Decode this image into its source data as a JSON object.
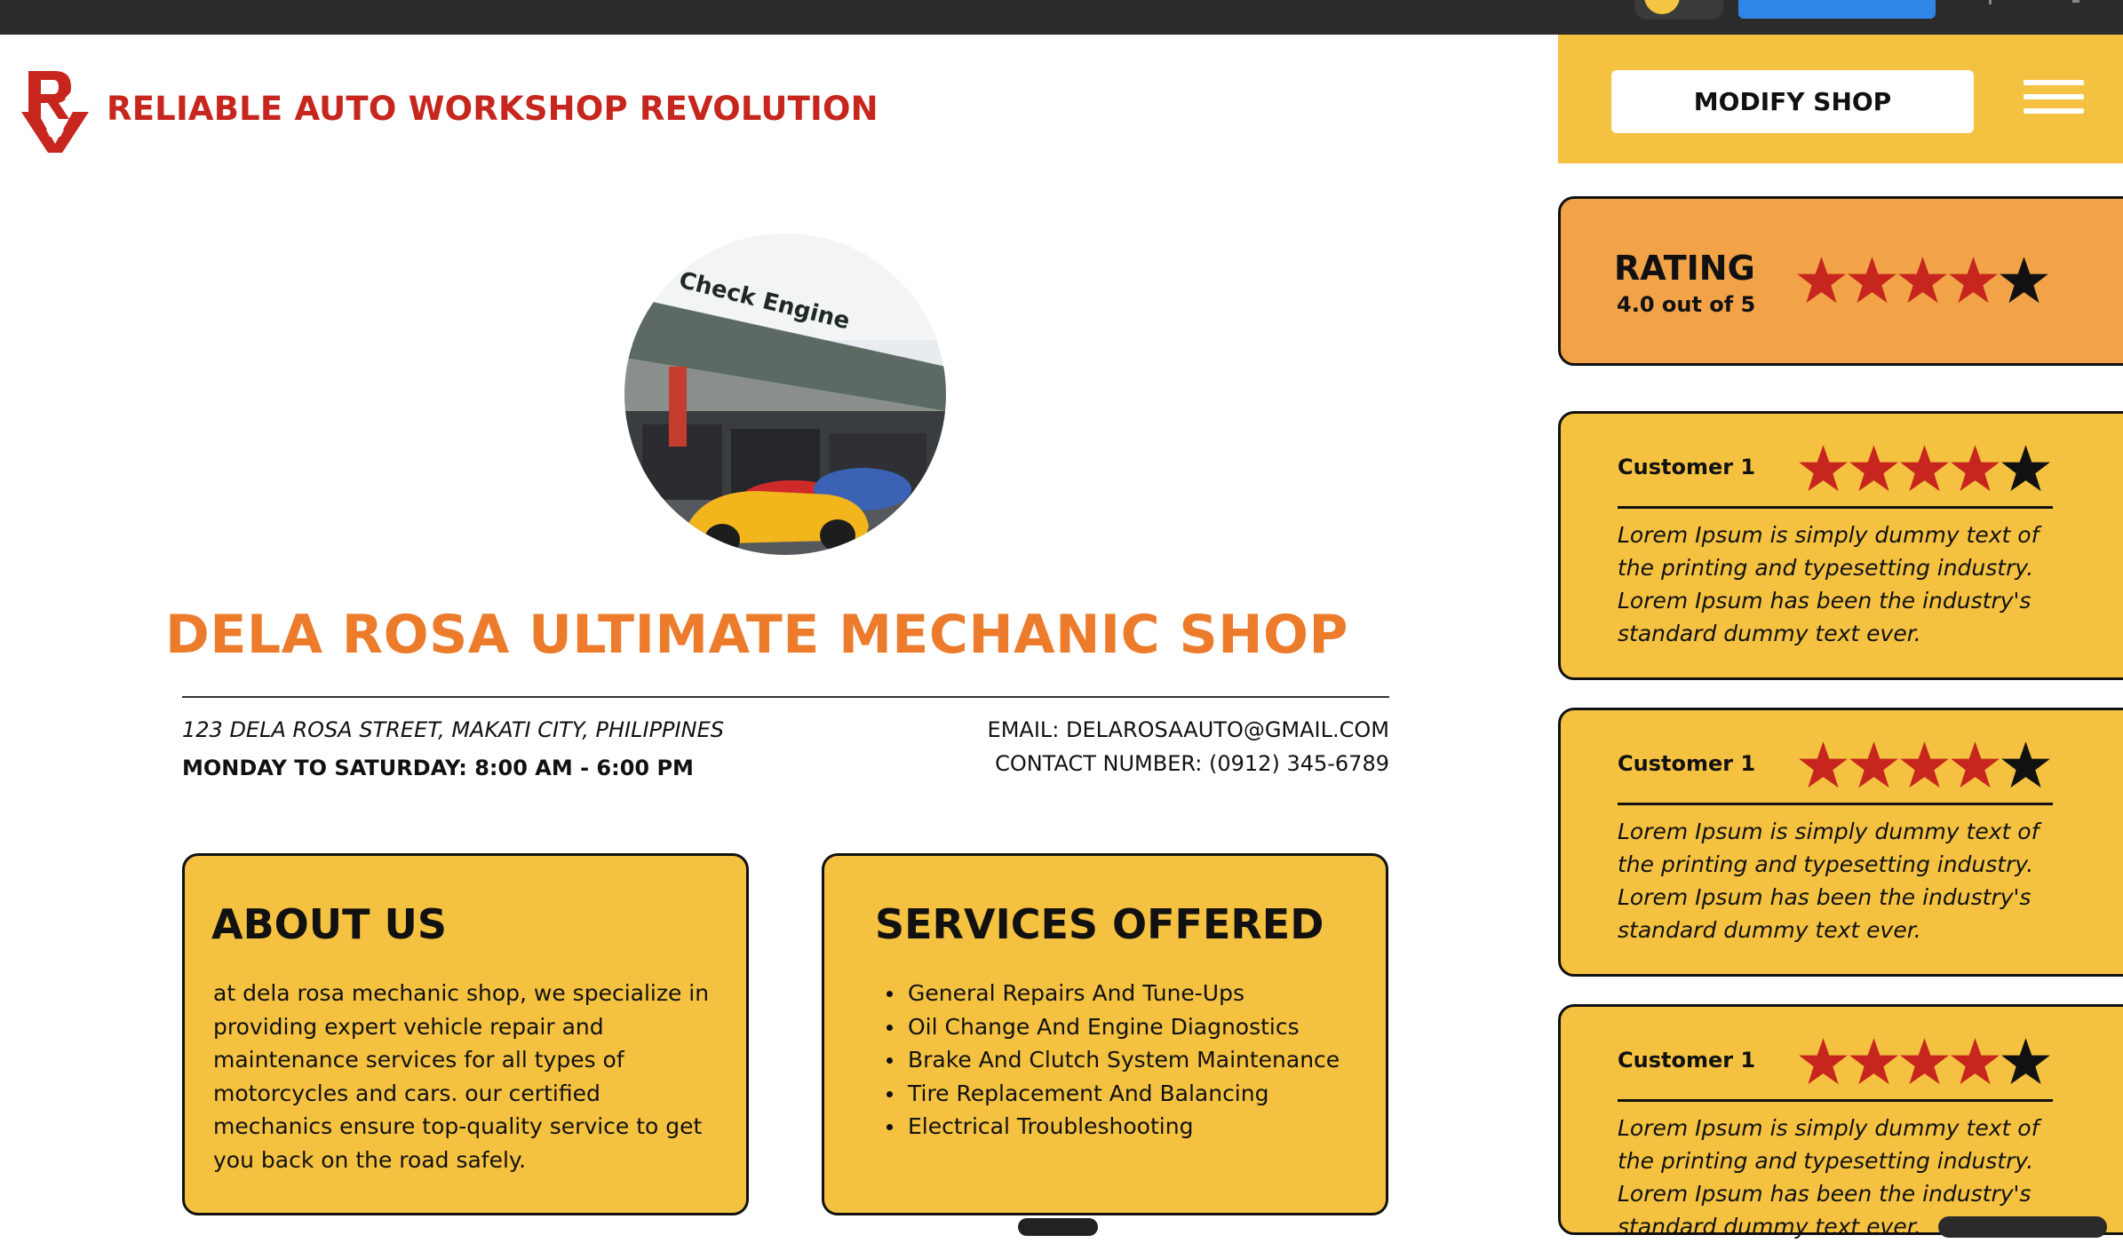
{
  "brand": {
    "name": "RELIABLE AUTO WORKSHOP REVOLUTION",
    "color": "#c6261d"
  },
  "header": {
    "modify_label": "MODIFY SHOP"
  },
  "rating": {
    "title": "RATING",
    "subtitle": "4.0 out of 5",
    "value": 4,
    "max": 5
  },
  "shop": {
    "name": "DELA ROSA ULTIMATE MECHANIC SHOP",
    "address": "123 DELA ROSA STREET, MAKATI CITY, PHILIPPINES",
    "hours": "MONDAY TO SATURDAY: 8:00 AM - 6:00 PM",
    "email": "EMAIL: DELAROSAAUTO@GMAIL.COM",
    "phone": "CONTACT NUMBER: (0912) 345-6789"
  },
  "about": {
    "heading": "ABOUT US",
    "text": "at dela rosa mechanic shop, we specialize in providing expert vehicle repair and maintenance services for all types of motorcycles and cars. our certified mechanics ensure top-quality service to get you back on the road safely."
  },
  "services": {
    "heading": "SERVICES OFFERED",
    "items": [
      "General Repairs And Tune-Ups",
      "Oil Change And Engine Diagnostics",
      "Brake And Clutch System Maintenance",
      "Tire Replacement And Balancing",
      "Electrical Troubleshooting"
    ]
  },
  "reviews": [
    {
      "name": "Customer 1",
      "rating": 4,
      "text": "Lorem Ipsum is simply dummy text of the printing and typesetting industry. Lorem Ipsum has been the industry's standard dummy text ever."
    },
    {
      "name": "Customer 1",
      "rating": 4,
      "text": "Lorem Ipsum is simply dummy text of the printing and typesetting industry. Lorem Ipsum has been the industry's standard dummy text ever."
    },
    {
      "name": "Customer 1",
      "rating": 4,
      "text": "Lorem Ipsum is simply dummy text of the printing and typesetting industry. Lorem Ipsum has been the industry's standard dummy text ever."
    }
  ],
  "colors": {
    "accent_orange": "#ec7b2c",
    "card_yellow": "#f4c140",
    "rating_orange": "#f2a247",
    "star_filled": "#c6261d",
    "star_empty": "#111111"
  },
  "icons": {
    "logo": "ra-logo-icon",
    "menu": "hamburger-menu-icon",
    "star": "star-icon"
  }
}
